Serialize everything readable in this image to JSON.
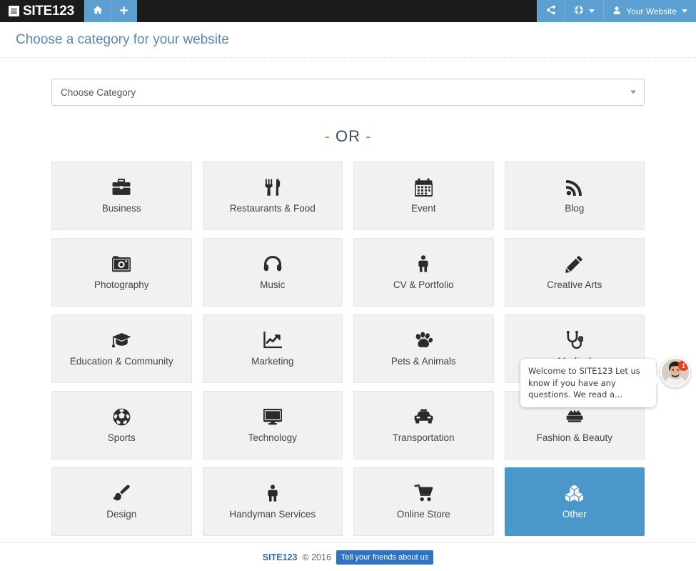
{
  "navbar": {
    "brand": "SITE123",
    "brand_icon": "list-icon",
    "buttons": [
      {
        "name": "home-button",
        "icon": "home-icon",
        "label": ""
      },
      {
        "name": "add-button",
        "icon": "plus-icon",
        "label": ""
      }
    ],
    "right_items": [
      {
        "name": "share-button",
        "icon": "share-icon",
        "label": ""
      },
      {
        "name": "language-button",
        "icon": "globe-icon",
        "label": ""
      },
      {
        "name": "account-menu",
        "icon": "user-icon",
        "label": "Your Website"
      }
    ]
  },
  "header": {
    "title": "Choose a category for your website"
  },
  "category_select": {
    "value": "Choose Category",
    "placeholder": "Choose Category"
  },
  "or_divider": {
    "left_dash": "-",
    "text": "OR",
    "right_dash": "-"
  },
  "categories": [
    {
      "label": "Business",
      "icon": "briefcase-icon",
      "selected": false
    },
    {
      "label": "Restaurants & Food",
      "icon": "cutlery-icon",
      "selected": false
    },
    {
      "label": "Event",
      "icon": "calendar-icon",
      "selected": false
    },
    {
      "label": "Blog",
      "icon": "rss-icon",
      "selected": false
    },
    {
      "label": "Photography",
      "icon": "camera-icon",
      "selected": false
    },
    {
      "label": "Music",
      "icon": "headphones-icon",
      "selected": false
    },
    {
      "label": "CV & Portfolio",
      "icon": "person-icon",
      "selected": false
    },
    {
      "label": "Creative Arts",
      "icon": "pencil-icon",
      "selected": false
    },
    {
      "label": "Education & Community",
      "icon": "graduation-cap-icon",
      "selected": false
    },
    {
      "label": "Marketing",
      "icon": "line-chart-icon",
      "selected": false
    },
    {
      "label": "Pets & Animals",
      "icon": "paw-icon",
      "selected": false
    },
    {
      "label": "Medical",
      "icon": "stethoscope-icon",
      "selected": false
    },
    {
      "label": "Sports",
      "icon": "soccer-ball-icon",
      "selected": false
    },
    {
      "label": "Technology",
      "icon": "desktop-icon",
      "selected": false
    },
    {
      "label": "Transportation",
      "icon": "taxi-icon",
      "selected": false
    },
    {
      "label": "Fashion & Beauty",
      "icon": "suitcase-icon",
      "selected": false
    },
    {
      "label": "Design",
      "icon": "paint-brush-icon",
      "selected": false
    },
    {
      "label": "Handyman Services",
      "icon": "person-icon",
      "selected": false
    },
    {
      "label": "Online Store",
      "icon": "shopping-cart-icon",
      "selected": false
    },
    {
      "label": "Other",
      "icon": "cubes-icon",
      "selected": true
    }
  ],
  "chat": {
    "message": "Welcome to SITE123 Let us know if you have any questions. We read a...",
    "badge": "1"
  },
  "footer": {
    "brand": "SITE123",
    "copyright": "© 2016",
    "share_button": "Tell your friends about us"
  },
  "colors": {
    "navbar_bg": "#1c1c1c",
    "accent_blue": "#5ba0d0",
    "selected_tile": "#4a97c9",
    "title_blue": "#5b87b5",
    "footer_button": "#2f73c4",
    "badge_red": "#e8401f"
  }
}
